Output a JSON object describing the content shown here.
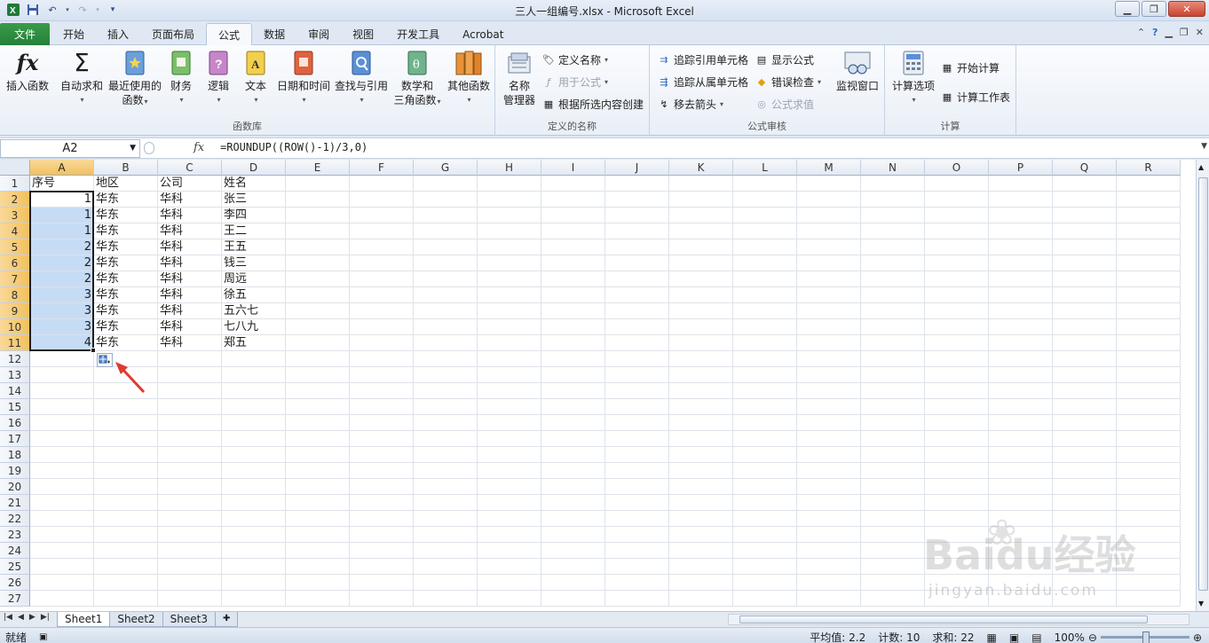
{
  "window": {
    "title": "三人一组编号.xlsx - Microsoft Excel"
  },
  "ribbon_tabs": {
    "file": "文件",
    "tabs": [
      "开始",
      "插入",
      "页面布局",
      "公式",
      "数据",
      "审阅",
      "视图",
      "开发工具",
      "Acrobat"
    ],
    "active": "公式"
  },
  "ribbon": {
    "function_library": {
      "label": "函数库",
      "insert_function": "插入函数",
      "autosum": "自动求和",
      "recent_1": "最近使用的",
      "recent_2": "函数",
      "financial": "财务",
      "logical": "逻辑",
      "text": "文本",
      "datetime": "日期和时间",
      "lookup": "查找与引用",
      "math_1": "数学和",
      "math_2": "三角函数",
      "more": "其他函数"
    },
    "defined_names": {
      "label": "定义的名称",
      "name_manager_1": "名称",
      "name_manager_2": "管理器",
      "define_name": "定义名称",
      "use_in_formula": "用于公式",
      "create_from_selection": "根据所选内容创建"
    },
    "formula_auditing": {
      "label": "公式审核",
      "trace_precedents": "追踪引用单元格",
      "trace_dependents": "追踪从属单元格",
      "remove_arrows": "移去箭头",
      "show_formulas": "显示公式",
      "error_checking": "错误检查",
      "evaluate_formula": "公式求值",
      "watch_window": "监视窗口"
    },
    "calculation": {
      "label": "计算",
      "options": "计算选项",
      "calc_now": "开始计算",
      "calc_sheet": "计算工作表"
    }
  },
  "formula_bar": {
    "name_box": "A2",
    "fx": "fx",
    "formula": "=ROUNDUP((ROW()-1)/3,0)"
  },
  "grid": {
    "columns": [
      "A",
      "B",
      "C",
      "D",
      "E",
      "F",
      "G",
      "H",
      "I",
      "J",
      "K",
      "L",
      "M",
      "N",
      "O",
      "P",
      "Q",
      "R"
    ],
    "row_numbers": [
      "1",
      "2",
      "3",
      "4",
      "5",
      "6",
      "7",
      "8",
      "9",
      "10",
      "11",
      "12",
      "13",
      "14",
      "15",
      "16",
      "17",
      "18",
      "19",
      "20",
      "21",
      "22",
      "23",
      "24",
      "25",
      "26",
      "27"
    ],
    "rows": [
      [
        "序号",
        "地区",
        "公司",
        "姓名"
      ],
      [
        "1",
        "华东",
        "华科",
        "张三"
      ],
      [
        "1",
        "华东",
        "华科",
        "李四"
      ],
      [
        "1",
        "华东",
        "华科",
        "王二"
      ],
      [
        "2",
        "华东",
        "华科",
        "王五"
      ],
      [
        "2",
        "华东",
        "华科",
        "钱三"
      ],
      [
        "2",
        "华东",
        "华科",
        "周远"
      ],
      [
        "3",
        "华东",
        "华科",
        "徐五"
      ],
      [
        "3",
        "华东",
        "华科",
        "五六七"
      ],
      [
        "3",
        "华东",
        "华科",
        "七八九"
      ],
      [
        "4",
        "华东",
        "华科",
        "郑五"
      ]
    ]
  },
  "sheets": {
    "tabs": [
      "Sheet1",
      "Sheet2",
      "Sheet3"
    ],
    "active": "Sheet1"
  },
  "status": {
    "ready": "就绪",
    "average": "平均值: 2.2",
    "count": "计数: 10",
    "sum": "求和: 22",
    "zoom": "100%"
  },
  "watermark": {
    "brand": "Baidu经验",
    "url": "jingyan.baidu.com"
  },
  "colors": {
    "file_tab": "#2c8a3f",
    "selection": "#c6dcf5",
    "header_selected": "#f4c86a",
    "arrow": "#e03a2f"
  }
}
